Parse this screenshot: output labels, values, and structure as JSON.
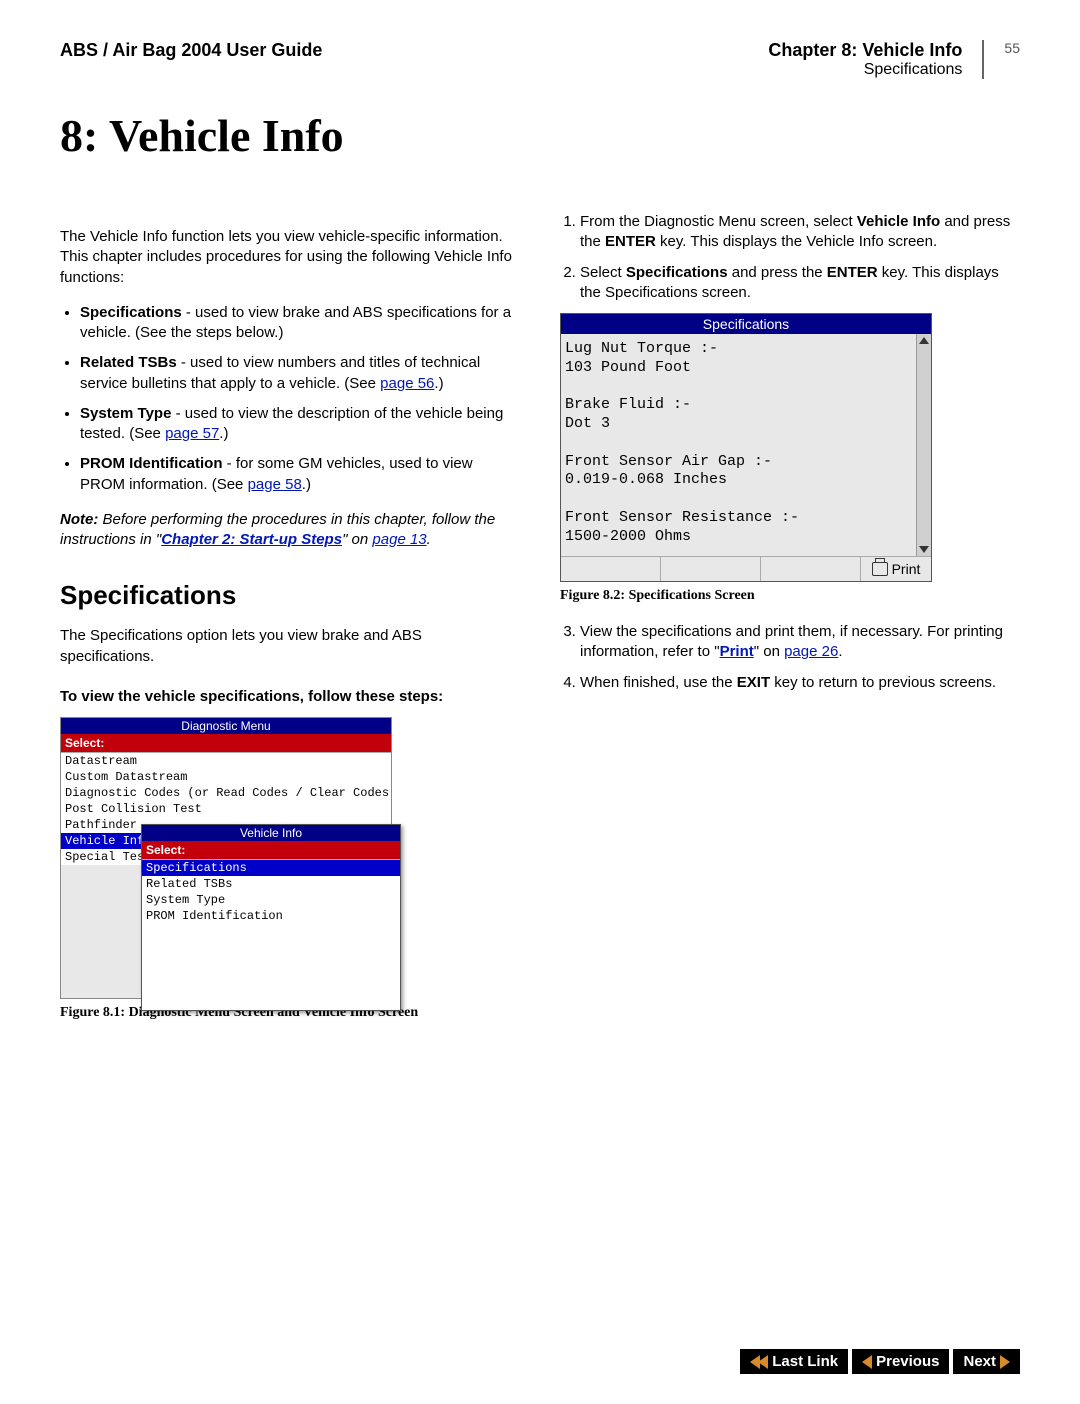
{
  "header": {
    "left": "ABS / Air Bag 2004 User Guide",
    "chapter": "Chapter 8: Vehicle Info",
    "section": "Specifications",
    "pagenum": "55"
  },
  "title": "8: Vehicle Info",
  "intro": "The Vehicle Info function lets you view vehicle-specific information. This chapter includes procedures for using the following Vehicle Info functions:",
  "bullets": {
    "b1_bold": "Specifications",
    "b1_rest": " - used to view brake and ABS specifications for a vehicle. (See the steps below.)",
    "b2_bold": "Related TSBs",
    "b2_rest_a": " - used to view numbers and titles of technical service bulletins that apply to a vehicle. (See ",
    "b2_link": "page 56",
    "b2_rest_b": ".)",
    "b3_bold": "System Type",
    "b3_rest_a": " - used to view the description of the vehicle being tested. (See ",
    "b3_link": "page 57",
    "b3_rest_b": ".)",
    "b4_bold": "PROM Identification",
    "b4_rest_a": " - for some GM vehicles, used to view PROM information. (See ",
    "b4_link": "page 58",
    "b4_rest_b": ".)"
  },
  "note": {
    "label": "Note:",
    "text_a": "  Before performing the procedures in this chapter, follow the instructions in \"",
    "link1": "Chapter 2: Start-up Steps",
    "text_b": "\" on ",
    "link2": "page 13",
    "text_c": "."
  },
  "spec_heading": "Specifications",
  "spec_intro": "The Specifications option lets you view brake and ABS specifications.",
  "steps_lead": "To view the vehicle specifications, follow these steps:",
  "fig1": {
    "caption": "Figure 8.1: Diagnostic Menu Screen and Vehicle Info Screen",
    "main_title": "Diagnostic Menu",
    "select": "Select:",
    "items": {
      "i0": "Datastream",
      "i1": "Custom Datastream",
      "i2": "Diagnostic Codes (or Read Codes / Clear Codes)",
      "i3": "Post Collision Test",
      "i4": "Pathfinder",
      "i5": "Vehicle Info",
      "i6": "Special Tests"
    },
    "sub_title": "Vehicle Info",
    "sub_select": "Select:",
    "sub_items": {
      "s0": "Specifications",
      "s1": "Related TSBs",
      "s2": "System Type",
      "s3": "PROM Identification"
    }
  },
  "right_steps": {
    "s1_a": "From the Diagnostic Menu screen, select ",
    "s1_b": "Vehicle Info",
    "s1_c": " and press the ",
    "s1_d": "ENTER",
    "s1_e": " key. This displays the Vehicle Info screen.",
    "s2_a": "Select ",
    "s2_b": "Specifications",
    "s2_c": " and press the ",
    "s2_d": "ENTER",
    "s2_e": " key. This displays the Specifications screen.",
    "s3_a": "View the specifications and print them, if necessary. For printing information, refer to \"",
    "s3_link1": "Print",
    "s3_b": "\" on ",
    "s3_link2": "page 26",
    "s3_c": ".",
    "s4_a": "When finished, use the ",
    "s4_b": "EXIT",
    "s4_c": " key to return to previous screens."
  },
  "fig2": {
    "caption": "Figure 8.2: Specifications Screen",
    "title": "Specifications",
    "body": "Lug Nut Torque :-\n103 Pound Foot\n\nBrake Fluid :-\nDot 3\n\nFront Sensor Air Gap :-\n0.019-0.068 Inches\n\nFront Sensor Resistance :-\n1500-2000 Ohms",
    "print": "Print"
  },
  "nav": {
    "lastlink": "Last Link",
    "previous": "Previous",
    "next": "Next"
  }
}
